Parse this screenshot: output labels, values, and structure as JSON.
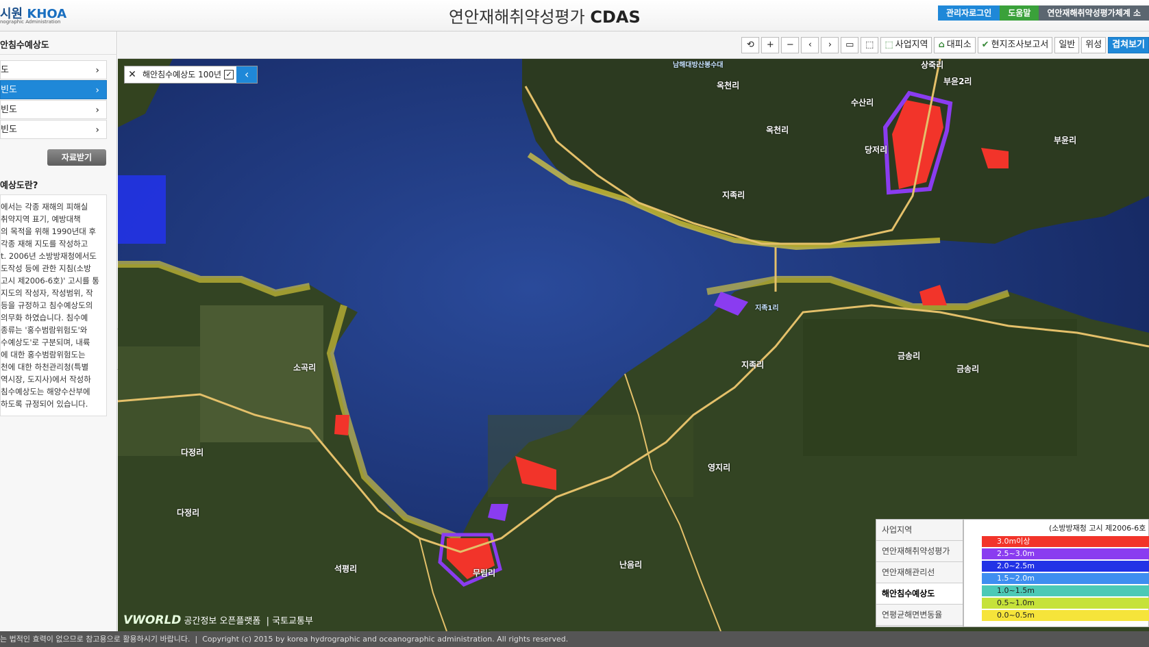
{
  "header": {
    "org_name": "시원",
    "org_abbr": "KHOA",
    "org_sub": "nographic Administration",
    "title_ko": "연안재해취약성평가",
    "title_en": "CDAS",
    "links": {
      "admin": "관리자로그인",
      "help": "도움말",
      "system": "연안재해취약성평가체계 소"
    }
  },
  "sidebar": {
    "title": "안침수예상도",
    "menu": [
      {
        "label": "도",
        "chev": "›"
      },
      {
        "label": "빈도",
        "chev": "›"
      },
      {
        "label": "빈도",
        "chev": "›"
      },
      {
        "label": "빈도",
        "chev": "›"
      }
    ],
    "download_label": "자료받기",
    "about_title": "예상도란?",
    "about_lines": [
      "에서는 각종 재해의 피해실",
      "취약지역 표기, 예방대책",
      "의 목적을 위해 1990년대 후",
      "각종 재해 지도를 작성하고",
      "t. 2006년 소방방재청에서도",
      "도작성 등에 관한 지침(소방",
      "고시 제2006-6호)' 고시를 통",
      "지도의 작성자, 작성범위, 작",
      "등을 규정하고 침수예상도의",
      "의무화 하였습니다. 침수예",
      "종류는 '홍수범람위험도'와",
      "수예상도'로 구분되며, 내륙",
      "에 대한 홍수범람위험도는",
      "천에 대한 하천관리청(특별",
      "역시장, 도지사)에서 작성하",
      "침수예상도는 해양수산부에",
      "하도록 규정되어 있습니다."
    ]
  },
  "toolbar": {
    "buttons": [
      "⟲",
      "+",
      "−",
      "‹",
      "›",
      "▭",
      "⬚"
    ],
    "business_area": "사업지역",
    "evacuation": "대피소",
    "field_report": "현지조사보고서",
    "normal": "일반",
    "satellite": "위성",
    "overlay": "겹쳐보기"
  },
  "layer_chip": {
    "close": "✕",
    "label": "해안침수예상도 100년",
    "check": "✓",
    "arrow": "‹"
  },
  "legend_tabs": [
    "사업지역",
    "연안재해취약성평가",
    "연안재해관리선",
    "해안침수예상도",
    "연평균해면변동율"
  ],
  "legend": {
    "note": "(소방방재청 고시 제2006-6호",
    "rows": [
      {
        "label": "3.0m이상",
        "color": "#f2342a"
      },
      {
        "label": "2.5~3.0m",
        "color": "#8a3cf0"
      },
      {
        "label": "2.0~2.5m",
        "color": "#2233e6"
      },
      {
        "label": "1.5~2.0m",
        "color": "#3e8ef0"
      },
      {
        "label": "1.0~1.5m",
        "color": "#4cc9b6"
      },
      {
        "label": "0.5~1.0m",
        "color": "#c6e23a"
      },
      {
        "label": "0.0~0.5m",
        "color": "#f6e43a"
      }
    ]
  },
  "map": {
    "vworld": "VWORLD",
    "vworld_sub": "공간정보 오픈플랫폼",
    "ministry": "국토교통부",
    "places": [
      {
        "name": "남해대방산봉수대",
        "sm": false
      },
      {
        "name": "옥천리",
        "sm": false
      },
      {
        "name": "상죽리",
        "sm": false
      },
      {
        "name": "부윤2리",
        "sm": false
      },
      {
        "name": "수산리",
        "sm": false
      },
      {
        "name": "당저리",
        "sm": false
      },
      {
        "name": "옥천리",
        "sm": false
      },
      {
        "name": "지족리",
        "sm": false
      },
      {
        "name": "지족리",
        "sm": false
      },
      {
        "name": "부윤리",
        "sm": false
      },
      {
        "name": "소곡리",
        "sm": false
      },
      {
        "name": "금송리",
        "sm": false
      },
      {
        "name": "금송리",
        "sm": false
      },
      {
        "name": "다정리",
        "sm": false
      },
      {
        "name": "다정리",
        "sm": false
      },
      {
        "name": "영지리",
        "sm": false
      },
      {
        "name": "석평리",
        "sm": false
      },
      {
        "name": "무림리",
        "sm": false
      },
      {
        "name": "난음리",
        "sm": false
      },
      {
        "name": "지족1리",
        "sm": false
      }
    ]
  },
  "footer": {
    "notice": "는 법적인 효력이 없으므로 참고용으로 활용하시기 바랍니다.",
    "copyright": "Copyright (c) 2015 by korea hydrographic and oceanographic administration. All rights reserved."
  }
}
